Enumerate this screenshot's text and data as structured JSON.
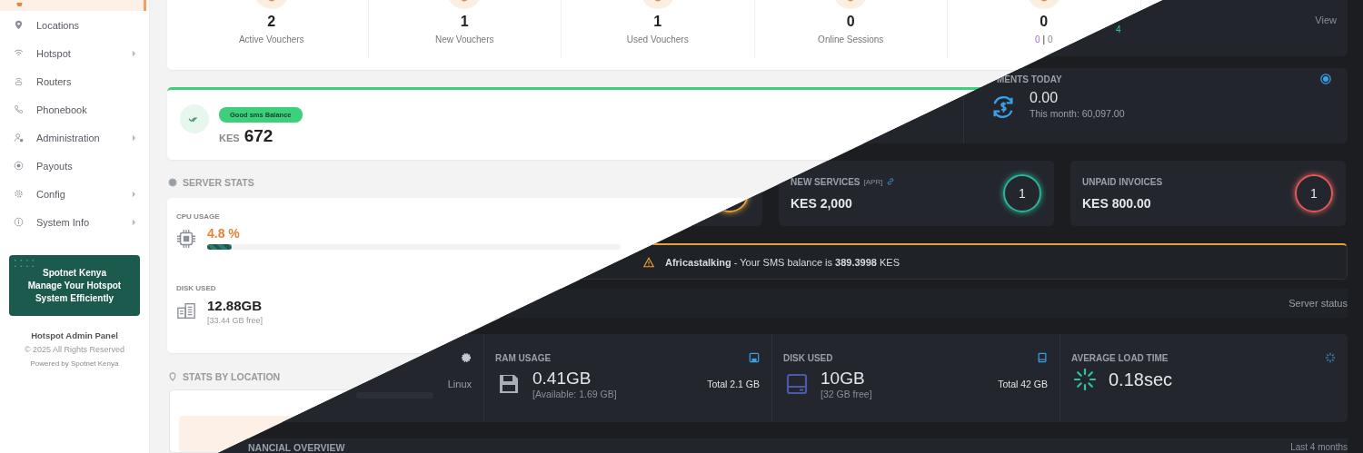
{
  "sidebar": {
    "top_item": {
      "selected": true
    },
    "items": [
      {
        "label": "Locations",
        "has_submenu": false
      },
      {
        "label": "Hotspot",
        "has_submenu": true
      },
      {
        "label": "Routers",
        "has_submenu": false
      },
      {
        "label": "Phonebook",
        "has_submenu": false
      },
      {
        "label": "Administration",
        "has_submenu": true
      },
      {
        "label": "Payouts",
        "has_submenu": false
      },
      {
        "label": "Config",
        "has_submenu": true
      },
      {
        "label": "System Info",
        "has_submenu": true
      }
    ],
    "promo": {
      "title": "Spotnet Kenya",
      "text": "Manage Your Hotspot System Efficiently"
    },
    "footer": {
      "title": "Hotspot Admin Panel",
      "copyright": "© 2025 All Rights Reserved",
      "powered_by": "Powered by Spotnet Kenya"
    }
  },
  "voucher_stats": [
    {
      "kind": "label",
      "value": "2",
      "label": "Active Vouchers"
    },
    {
      "kind": "label",
      "value": "1",
      "label": "New Vouchers"
    },
    {
      "kind": "label",
      "value": "1",
      "label": "Used Vouchers"
    },
    {
      "kind": "label",
      "value": "0",
      "label": "Online Sessions"
    },
    {
      "kind": "split",
      "value": "0",
      "parts": [
        "0",
        "|",
        "0"
      ]
    }
  ],
  "sms_balance": {
    "badge": "Good sms Balance",
    "currency": "KES",
    "amount": "672"
  },
  "server_stats": {
    "title": "SERVER STATS",
    "cpu": {
      "label": "CPU USAGE",
      "value": "4.8 %",
      "level": 0.06
    },
    "disk": {
      "label": "DISK USED",
      "value": "12.88GB",
      "free": "[33.44 GB free]"
    }
  },
  "stats_by_location": {
    "title": "STATS BY LOCATION"
  },
  "dark": {
    "voucher_fragment": "4",
    "view_link": "View",
    "payments_today": {
      "label": "MENTS TODAY",
      "value": "0.00",
      "month": "This month: 60,097.00"
    },
    "cards": [
      {
        "kind": "ring_only",
        "color": "#e6a23c"
      },
      {
        "kind": "stat",
        "title": "NEW SERVICES",
        "tag": "[APR]",
        "has_link": true,
        "value": "KES 2,000",
        "count": "1",
        "color": "#2bb59a"
      },
      {
        "kind": "stat",
        "title": "UNPAID INVOICES",
        "has_link": false,
        "value": "KES 800.00",
        "count": "1",
        "color": "#e05a5a"
      }
    ],
    "alert": {
      "text": "**Africastalking** - Your SMS balance is **389.3998** KES"
    },
    "server_status": {
      "title": "Server status",
      "os": "Linux",
      "ram": {
        "label": "RAM USAGE",
        "value": "0.41GB",
        "detail": "[Available: 1.69 GB]",
        "total": "Total 2.1 GB"
      },
      "disk": {
        "label": "DISK USED",
        "value": "10GB",
        "detail": "[32 GB free]",
        "total": "Total 42 GB"
      },
      "load": {
        "label": "AVERAGE LOAD TIME",
        "value": "0.18sec"
      }
    },
    "financial": {
      "title": "NANCIAL OVERVIEW",
      "range": "Last 4 months"
    }
  }
}
